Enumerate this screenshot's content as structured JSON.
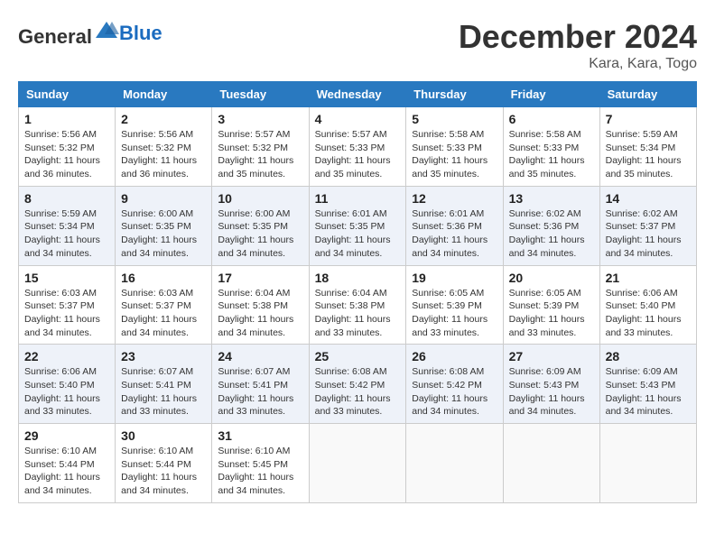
{
  "logo": {
    "text_general": "General",
    "text_blue": "Blue"
  },
  "title": "December 2024",
  "subtitle": "Kara, Kara, Togo",
  "days_of_week": [
    "Sunday",
    "Monday",
    "Tuesday",
    "Wednesday",
    "Thursday",
    "Friday",
    "Saturday"
  ],
  "weeks": [
    [
      {
        "day": 1,
        "sunrise": "5:56 AM",
        "sunset": "5:32 PM",
        "daylight": "11 hours and 36 minutes."
      },
      {
        "day": 2,
        "sunrise": "5:56 AM",
        "sunset": "5:32 PM",
        "daylight": "11 hours and 36 minutes."
      },
      {
        "day": 3,
        "sunrise": "5:57 AM",
        "sunset": "5:32 PM",
        "daylight": "11 hours and 35 minutes."
      },
      {
        "day": 4,
        "sunrise": "5:57 AM",
        "sunset": "5:33 PM",
        "daylight": "11 hours and 35 minutes."
      },
      {
        "day": 5,
        "sunrise": "5:58 AM",
        "sunset": "5:33 PM",
        "daylight": "11 hours and 35 minutes."
      },
      {
        "day": 6,
        "sunrise": "5:58 AM",
        "sunset": "5:33 PM",
        "daylight": "11 hours and 35 minutes."
      },
      {
        "day": 7,
        "sunrise": "5:59 AM",
        "sunset": "5:34 PM",
        "daylight": "11 hours and 35 minutes."
      }
    ],
    [
      {
        "day": 8,
        "sunrise": "5:59 AM",
        "sunset": "5:34 PM",
        "daylight": "11 hours and 34 minutes."
      },
      {
        "day": 9,
        "sunrise": "6:00 AM",
        "sunset": "5:35 PM",
        "daylight": "11 hours and 34 minutes."
      },
      {
        "day": 10,
        "sunrise": "6:00 AM",
        "sunset": "5:35 PM",
        "daylight": "11 hours and 34 minutes."
      },
      {
        "day": 11,
        "sunrise": "6:01 AM",
        "sunset": "5:35 PM",
        "daylight": "11 hours and 34 minutes."
      },
      {
        "day": 12,
        "sunrise": "6:01 AM",
        "sunset": "5:36 PM",
        "daylight": "11 hours and 34 minutes."
      },
      {
        "day": 13,
        "sunrise": "6:02 AM",
        "sunset": "5:36 PM",
        "daylight": "11 hours and 34 minutes."
      },
      {
        "day": 14,
        "sunrise": "6:02 AM",
        "sunset": "5:37 PM",
        "daylight": "11 hours and 34 minutes."
      }
    ],
    [
      {
        "day": 15,
        "sunrise": "6:03 AM",
        "sunset": "5:37 PM",
        "daylight": "11 hours and 34 minutes."
      },
      {
        "day": 16,
        "sunrise": "6:03 AM",
        "sunset": "5:37 PM",
        "daylight": "11 hours and 34 minutes."
      },
      {
        "day": 17,
        "sunrise": "6:04 AM",
        "sunset": "5:38 PM",
        "daylight": "11 hours and 34 minutes."
      },
      {
        "day": 18,
        "sunrise": "6:04 AM",
        "sunset": "5:38 PM",
        "daylight": "11 hours and 33 minutes."
      },
      {
        "day": 19,
        "sunrise": "6:05 AM",
        "sunset": "5:39 PM",
        "daylight": "11 hours and 33 minutes."
      },
      {
        "day": 20,
        "sunrise": "6:05 AM",
        "sunset": "5:39 PM",
        "daylight": "11 hours and 33 minutes."
      },
      {
        "day": 21,
        "sunrise": "6:06 AM",
        "sunset": "5:40 PM",
        "daylight": "11 hours and 33 minutes."
      }
    ],
    [
      {
        "day": 22,
        "sunrise": "6:06 AM",
        "sunset": "5:40 PM",
        "daylight": "11 hours and 33 minutes."
      },
      {
        "day": 23,
        "sunrise": "6:07 AM",
        "sunset": "5:41 PM",
        "daylight": "11 hours and 33 minutes."
      },
      {
        "day": 24,
        "sunrise": "6:07 AM",
        "sunset": "5:41 PM",
        "daylight": "11 hours and 33 minutes."
      },
      {
        "day": 25,
        "sunrise": "6:08 AM",
        "sunset": "5:42 PM",
        "daylight": "11 hours and 33 minutes."
      },
      {
        "day": 26,
        "sunrise": "6:08 AM",
        "sunset": "5:42 PM",
        "daylight": "11 hours and 34 minutes."
      },
      {
        "day": 27,
        "sunrise": "6:09 AM",
        "sunset": "5:43 PM",
        "daylight": "11 hours and 34 minutes."
      },
      {
        "day": 28,
        "sunrise": "6:09 AM",
        "sunset": "5:43 PM",
        "daylight": "11 hours and 34 minutes."
      }
    ],
    [
      {
        "day": 29,
        "sunrise": "6:10 AM",
        "sunset": "5:44 PM",
        "daylight": "11 hours and 34 minutes."
      },
      {
        "day": 30,
        "sunrise": "6:10 AM",
        "sunset": "5:44 PM",
        "daylight": "11 hours and 34 minutes."
      },
      {
        "day": 31,
        "sunrise": "6:10 AM",
        "sunset": "5:45 PM",
        "daylight": "11 hours and 34 minutes."
      },
      null,
      null,
      null,
      null
    ]
  ]
}
